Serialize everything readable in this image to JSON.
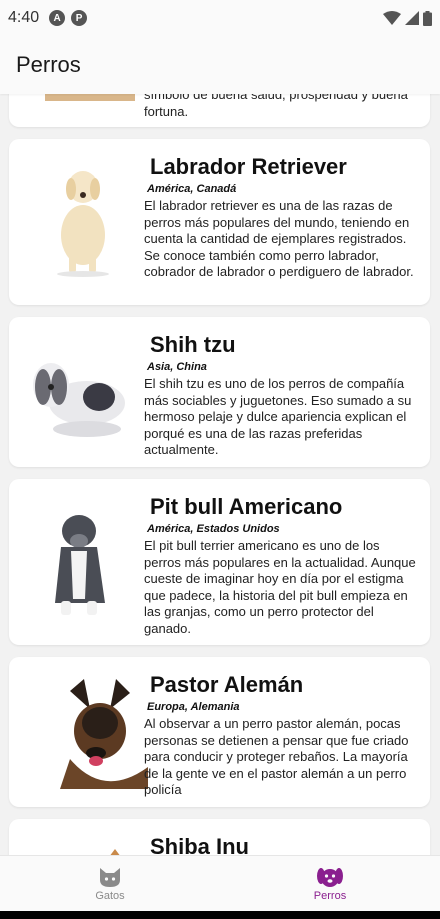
{
  "status": {
    "time": "4:40",
    "badge1": "A",
    "badge2": "P"
  },
  "appbar": {
    "title": "Perros"
  },
  "partial_card": {
    "desc": "símbolo de buena salud, prosperidad y buena fortuna."
  },
  "cards": [
    {
      "title": "Labrador Retriever",
      "origin": "América, Canadá",
      "desc": "El labrador retriever es una de las razas de perros más populares del mundo, teniendo en cuenta la cantidad de ejemplares registrados. Se conoce también como perro labrador, cobrador de labrador o perdiguero de labrador."
    },
    {
      "title": "Shih tzu",
      "origin": "Asia, China",
      "desc": "El shih tzu es uno de los perros de compañía más sociables y juguetones. Eso sumado a su hermoso pelaje y dulce apariencia explican el porqué es una de las razas preferidas actualmente."
    },
    {
      "title": "Pit bull Americano",
      "origin": "América, Estados Unidos",
      "desc": "El pit bull terrier americano es uno de los perros más populares en la actualidad. Aunque cueste de imaginar hoy en día por el estigma que padece, la historia del pit bull empieza en las granjas, como un perro protector del ganado."
    },
    {
      "title": "Pastor Alemán",
      "origin": "Europa, Alemania",
      "desc": "Al observar a un perro pastor alemán, pocas personas se detienen a pensar que fue criado para conducir y proteger rebaños. La mayoría de la gente ve en el pastor alemán a un perro policía"
    },
    {
      "title": "Shiba Inu"
    }
  ],
  "nav": {
    "items": [
      {
        "label": "Gatos",
        "icon": "cat-icon"
      },
      {
        "label": "Perros",
        "icon": "dog-icon"
      }
    ],
    "active_color": "#8a1f8f",
    "inactive_color": "#8a8a8a"
  }
}
